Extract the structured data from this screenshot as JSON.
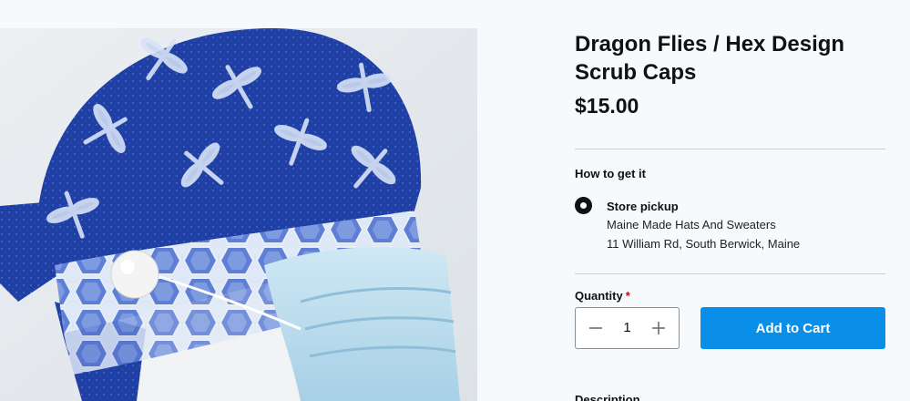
{
  "product": {
    "title": "Dragon Flies / Hex Design Scrub Caps",
    "price": "$15.00",
    "image_icon": "product-photo-scrub-cap"
  },
  "fulfillment": {
    "heading": "How to get it",
    "option_title": "Store pickup",
    "option_selected": true,
    "store_name": "Maine Made Hats And Sweaters",
    "store_address": "11 William Rd, South Berwick, Maine"
  },
  "quantity": {
    "label": "Quantity",
    "required_mark": "*",
    "value": "1",
    "minus_icon": "minus-icon",
    "plus_icon": "plus-icon"
  },
  "cart": {
    "add_label": "Add to Cart",
    "button_color": "#0a8fe8"
  },
  "description": {
    "heading": "Description"
  }
}
